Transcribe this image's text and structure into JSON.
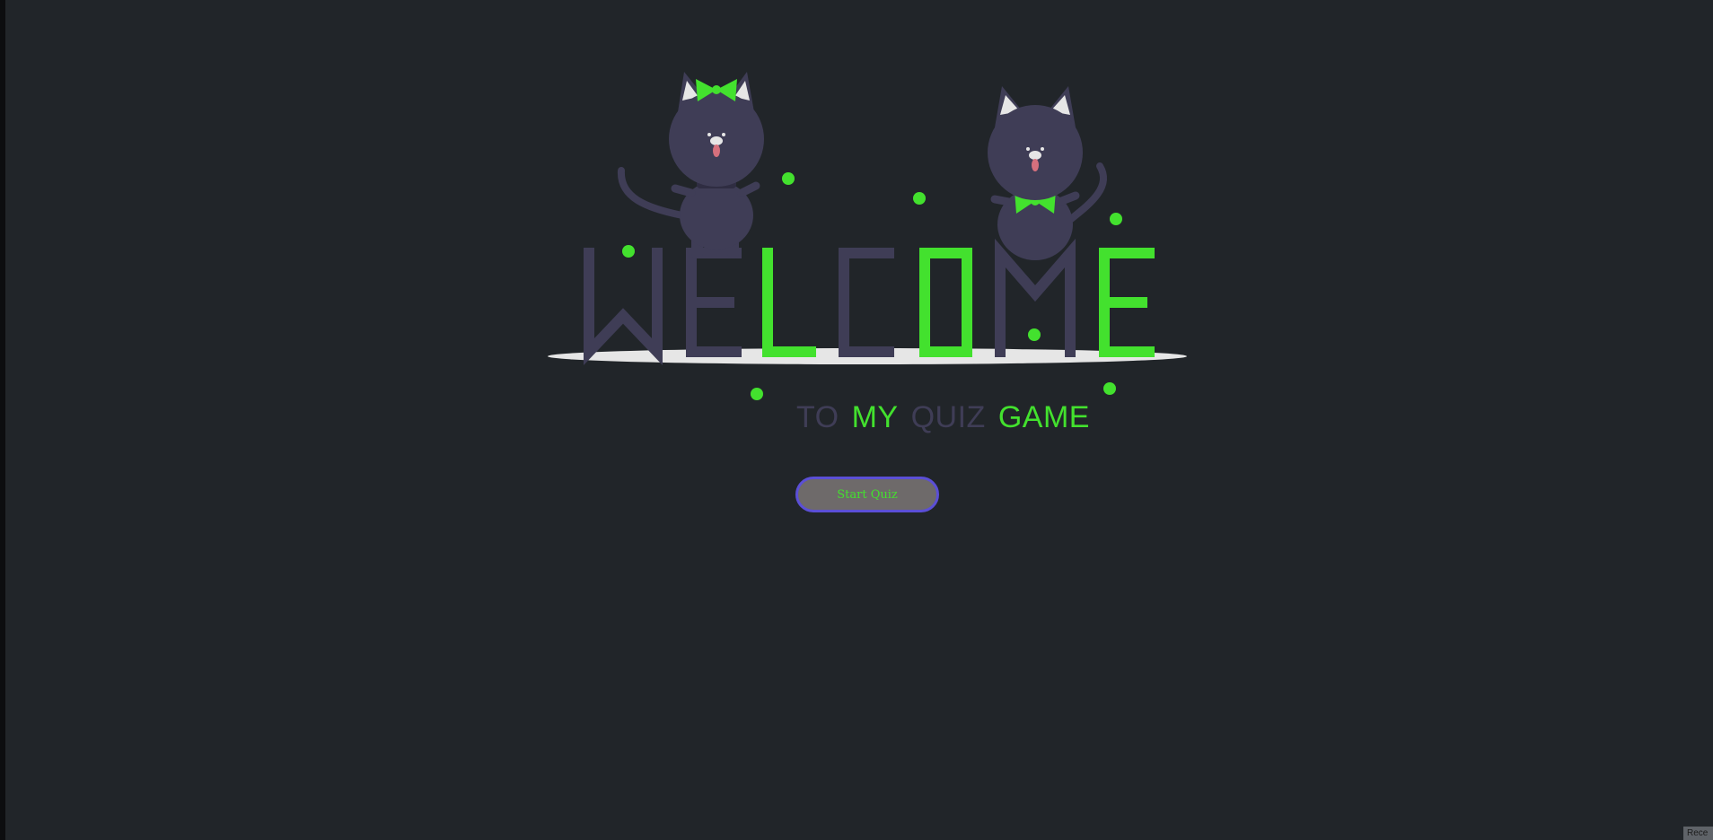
{
  "colors": {
    "background": "#212529",
    "dark_accent": "#3f3d56",
    "green_accent": "#43e12e",
    "button_fill": "#6e6a6a",
    "button_border": "#5b4fd6"
  },
  "hero": {
    "headline_letters": [
      "W",
      "E",
      "L",
      "C",
      "O",
      "M",
      "E"
    ],
    "subtitle": {
      "word1": "TO",
      "word2": "MY",
      "word3": "QUIZ",
      "word4": "GAME"
    }
  },
  "start_button": {
    "label": "Start Quiz"
  },
  "corner_tab": {
    "label": "Rece"
  }
}
